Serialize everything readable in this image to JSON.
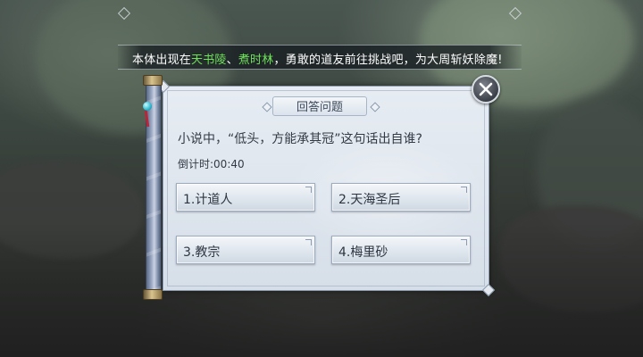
{
  "notice": {
    "segments": [
      {
        "text": "本体出现在",
        "highlight": false
      },
      {
        "text": "天书陵",
        "highlight": true
      },
      {
        "text": "、",
        "highlight": false
      },
      {
        "text": "煮时林",
        "highlight": true
      },
      {
        "text": "，勇敢的道友前往挑战吧，为大周斩妖除魔!",
        "highlight": false
      }
    ],
    "highlight_color": "#6ee05a"
  },
  "dialog": {
    "title": "回答问题",
    "question": "小说中，“低头，方能承其冠”这句话出自谁?",
    "countdown_label": "倒计时:",
    "countdown_value": "00:40",
    "answers": [
      {
        "label": "1.计道人"
      },
      {
        "label": "2.天海圣后"
      },
      {
        "label": "3.教宗"
      },
      {
        "label": "4.梅里砂"
      }
    ]
  },
  "icons": {
    "close": "close-icon"
  }
}
